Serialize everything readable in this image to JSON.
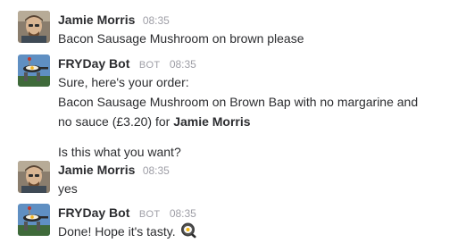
{
  "messages": [
    {
      "author": "Jamie Morris",
      "time": "08:35",
      "avatar_icon": "user-avatar-icon",
      "lines": [
        "Bacon Sausage Mushroom on brown please"
      ]
    },
    {
      "author": "FRYDay Bot",
      "bot_tag": "BOT",
      "time": "08:35",
      "avatar_icon": "bot-avatar-icon",
      "line1": "Sure, here's your order:",
      "line2": "Bacon Sausage Mushroom on Brown Bap with no margarine and",
      "line3_prefix": "no sauce (£3.20) for ",
      "line3_bold": "Jamie Morris",
      "line4": "Is this what you want?"
    },
    {
      "author": "Jamie Morris",
      "time": "08:35",
      "avatar_icon": "user-avatar-icon",
      "lines": [
        "yes"
      ]
    },
    {
      "author": "FRYDay Bot",
      "bot_tag": "BOT",
      "time": "08:35",
      "avatar_icon": "bot-avatar-icon",
      "text": "Done! Hope it's tasty.",
      "emoji": "frying-pan-egg-icon"
    }
  ],
  "colors": {
    "text": "#2c2d30",
    "meta": "#9e9ea6",
    "background": "#ffffff"
  }
}
